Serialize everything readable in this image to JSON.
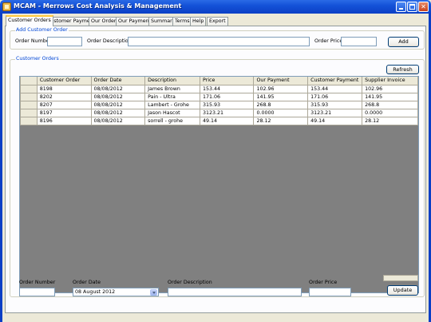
{
  "window": {
    "title": "MCAM - Merrows Cost Analysis & Management"
  },
  "tabs": [
    {
      "label": "Customer Orders"
    },
    {
      "label": "Customer Payments"
    },
    {
      "label": "Our Orders"
    },
    {
      "label": "Our Payments"
    },
    {
      "label": "Summary"
    },
    {
      "label": "Terms"
    },
    {
      "label": "Help"
    },
    {
      "label": "Export"
    }
  ],
  "add_order": {
    "group_title": "Add Customer Order",
    "order_number_label": "Order Number",
    "order_number_value": "",
    "order_description_label": "Order Description",
    "order_description_value": "",
    "order_price_label": "Order Price",
    "order_price_value": "",
    "add_label": "Add"
  },
  "orders": {
    "group_title": "Customer Orders",
    "refresh_label": "Refresh",
    "columns": [
      "Customer Order",
      "Order Date",
      "Description",
      "Price",
      "Our Payment",
      "Customer Payment",
      "Supplier Invoice"
    ],
    "rows": [
      [
        "8198",
        "08/08/2012",
        "James Brown",
        "153.44",
        "102.96",
        "153.44",
        "102.96"
      ],
      [
        "8202",
        "08/08/2012",
        "Pain - Ultra",
        "171.06",
        "141.95",
        "171.06",
        "141.95"
      ],
      [
        "8207",
        "08/08/2012",
        "Lambert - Grohe",
        "315.93",
        "268.8",
        "315.93",
        "268.8"
      ],
      [
        "8197",
        "08/08/2012",
        "Jason Hascot",
        "3123.21",
        "0.0000",
        "3123.21",
        "0.0000"
      ],
      [
        "8196",
        "08/08/2012",
        "sorrell - grohe",
        "49.14",
        "28.12",
        "49.14",
        "28.12"
      ]
    ]
  },
  "edit_order": {
    "order_number_label": "Order Number",
    "order_number_value": "",
    "order_date_label": "Order Date",
    "order_date_day": "08",
    "order_date_month": "August",
    "order_date_year": "2012",
    "order_description_label": "Order Description",
    "order_description_value": "",
    "order_price_label": "Order Price",
    "order_price_value": "",
    "update_label": "Update"
  }
}
